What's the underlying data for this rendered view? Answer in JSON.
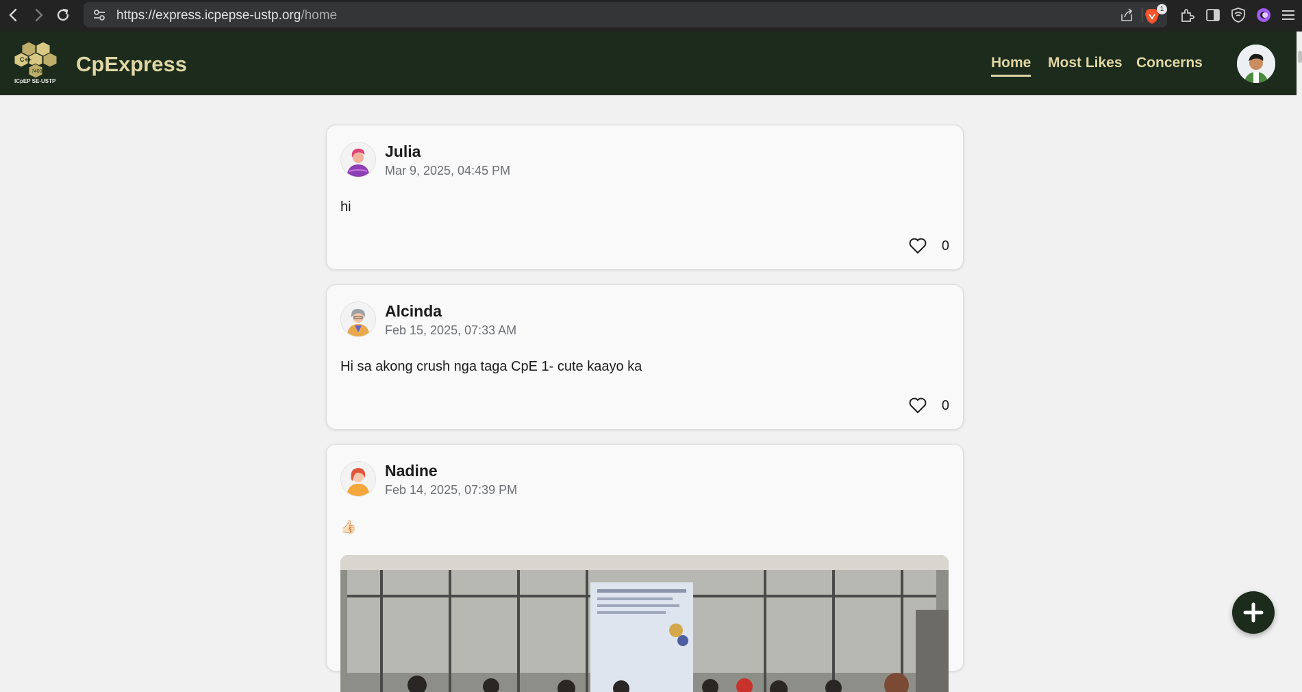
{
  "browser": {
    "url_main": "https://express.icpepse-ustp.org",
    "url_path": "/home",
    "badge_count": "1"
  },
  "header": {
    "logo_alt": "ICpEP SE - USTP",
    "brand": "CpExpress",
    "nav": [
      {
        "label": "Home",
        "active": true
      },
      {
        "label": "Most Likes",
        "active": false
      },
      {
        "label": "Concerns",
        "active": false
      }
    ]
  },
  "posts": [
    {
      "author": "Julia",
      "date": "Mar 9, 2025, 04:45 PM",
      "text": "hi",
      "likes": "0"
    },
    {
      "author": "Alcinda",
      "date": "Feb 15, 2025, 07:33 AM",
      "text": "Hi sa akong crush nga taga CpE 1- cute kaayo ka",
      "likes": "0"
    },
    {
      "author": "Nadine",
      "date": "Feb 14, 2025, 07:39 PM",
      "text": "👍🏻",
      "has_image": true
    }
  ],
  "fab": {
    "icon": "plus-icon"
  },
  "colors": {
    "header_bg": "#1c2b1b",
    "accent": "#dfd6a4",
    "page_bg": "#f1f1f1"
  }
}
